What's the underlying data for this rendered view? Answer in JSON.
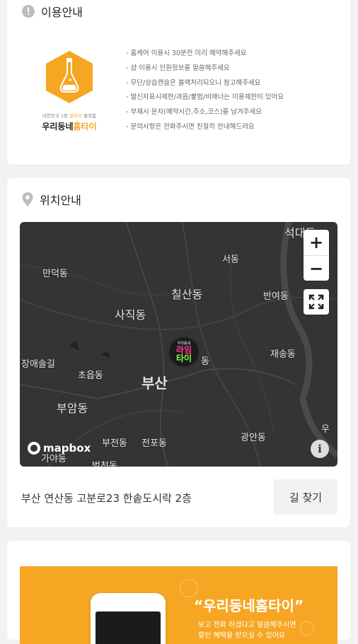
{
  "usage": {
    "title": "이용안내",
    "logo": {
      "sub_pre": "대한민국 1등 ",
      "sub_hl": "홈타이",
      "sub_post": " 플랫폼",
      "name_pre": "우리동네",
      "name_hl": "홈타이"
    },
    "rules": [
      "- 홈케어 이용시 30분전 미리 예약해주세요",
      "- 샵 이용시 인원정보를 말씀해주세요",
      "- 무단/상습캔슬은 블랙처리되오니 참고해주세요",
      "- 발신자표시제한/과음/불법/비매너는 이용제한이 있어요",
      "- 부재시 문자(예약시간,주소,코스)를 남겨주세요",
      "- 문의사항은 전화주시면 친절히 안내해드려요"
    ]
  },
  "location": {
    "title": "위치안내",
    "map": {
      "places": [
        "석대동",
        "서동",
        "만덕동",
        "칠산동",
        "반여동",
        "사직동",
        "재송동",
        "장애솔길",
        "초읍동",
        "부산",
        "부암동",
        "광안동",
        "부전동",
        "전포동",
        "가야동",
        "범천동",
        "우",
        "동"
      ],
      "marker": {
        "line1": "우리동네",
        "line2": "라임",
        "line3": "타이"
      },
      "zoom_in": "+",
      "zoom_out": "−",
      "attribution": "mapbox",
      "info": "i"
    },
    "address": "부산 연산동 고분로23 한솥도시락 2층",
    "directions_label": "길 찾기"
  },
  "promo": {
    "title": "“우리동네홈타이”",
    "sub_line1": "보고 전화 하셨다고 말씀해주시면",
    "sub_line2": "할인 혜택을 받으실 수 있어요"
  },
  "colors": {
    "accent": "#f6a623",
    "map_bg": "#343434",
    "page_bg": "#f2f2f2"
  }
}
